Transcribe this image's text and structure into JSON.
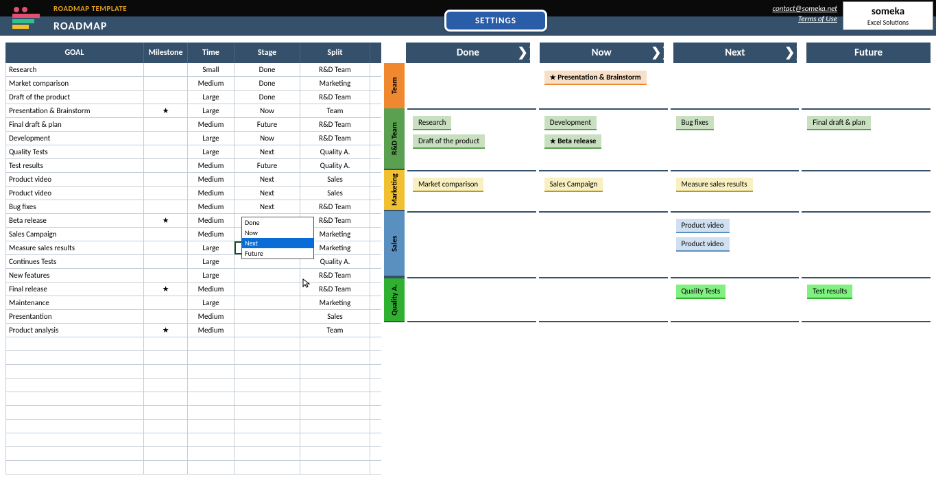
{
  "header": {
    "small_title": "ROADMAP TEMPLATE",
    "big_title": "ROADMAP",
    "settings": "SETTINGS",
    "contact": "contact@someka.net",
    "terms": "Terms of Use",
    "logo_text": "someka",
    "logo_sub": "Excel Solutions"
  },
  "columns": {
    "goal": "GOAL",
    "milestone": "Milestone",
    "time": "Time",
    "stage": "Stage",
    "split": "Split"
  },
  "stages": [
    "Done",
    "Now",
    "Next",
    "Future"
  ],
  "dropdown": [
    "Done",
    "Now",
    "Next",
    "Future"
  ],
  "lanes": {
    "team": "Team",
    "rd": "R&D Team",
    "mkt": "Marketing",
    "sales": "Sales",
    "qa": "Quality A."
  },
  "rows": [
    {
      "goal": "Research",
      "mile": "",
      "time": "Small",
      "stage": "Done",
      "split": "R&D Team"
    },
    {
      "goal": "Market comparison",
      "mile": "",
      "time": "Medium",
      "stage": "Done",
      "split": "Marketing"
    },
    {
      "goal": "Draft of the product",
      "mile": "",
      "time": "Large",
      "stage": "Done",
      "split": "R&D Team"
    },
    {
      "goal": "Presentation & Brainstorm",
      "mile": "★",
      "time": "Large",
      "stage": "Now",
      "split": "Team"
    },
    {
      "goal": "Final draft & plan",
      "mile": "",
      "time": "Medium",
      "stage": "Future",
      "split": "R&D Team"
    },
    {
      "goal": "Development",
      "mile": "",
      "time": "Large",
      "stage": "Now",
      "split": "R&D Team"
    },
    {
      "goal": "Quality Tests",
      "mile": "",
      "time": "Large",
      "stage": "Next",
      "split": "Quality A."
    },
    {
      "goal": "Test results",
      "mile": "",
      "time": "Medium",
      "stage": "Future",
      "split": "Quality A."
    },
    {
      "goal": "Product video",
      "mile": "",
      "time": "Medium",
      "stage": "Next",
      "split": "Sales"
    },
    {
      "goal": "Product video",
      "mile": "",
      "time": "Medium",
      "stage": "Next",
      "split": "Sales"
    },
    {
      "goal": "Bug fixes",
      "mile": "",
      "time": "Medium",
      "stage": "Next",
      "split": "R&D Team"
    },
    {
      "goal": "Beta release",
      "mile": "★",
      "time": "Medium",
      "stage": "Now",
      "split": "R&D Team"
    },
    {
      "goal": "Sales Campaign",
      "mile": "",
      "time": "Medium",
      "stage": "Now",
      "split": "Marketing"
    },
    {
      "goal": "Measure sales results",
      "mile": "",
      "time": "Large",
      "stage": "Next",
      "split": "Marketing"
    },
    {
      "goal": "Continues Tests",
      "mile": "",
      "time": "Large",
      "stage": "",
      "split": "Quality A."
    },
    {
      "goal": "New features",
      "mile": "",
      "time": "Large",
      "stage": "",
      "split": "R&D Team"
    },
    {
      "goal": "Final release",
      "mile": "★",
      "time": "Medium",
      "stage": "",
      "split": "R&D Team"
    },
    {
      "goal": "Maintenance",
      "mile": "",
      "time": "Large",
      "stage": "",
      "split": "Marketing"
    },
    {
      "goal": "Presentantion",
      "mile": "",
      "time": "Medium",
      "stage": "",
      "split": "Sales"
    },
    {
      "goal": "Product analysis",
      "mile": "★",
      "time": "Medium",
      "stage": "",
      "split": "Team"
    }
  ],
  "cards": {
    "team": {
      "Now": [
        {
          "t": "Presentation & Brainstorm",
          "m": true
        }
      ]
    },
    "rd": {
      "Done": [
        {
          "t": "Research"
        },
        {
          "t": "Draft of the product"
        }
      ],
      "Now": [
        {
          "t": "Development"
        },
        {
          "t": "Beta release",
          "m": true
        }
      ],
      "Next": [
        {
          "t": "Bug fixes"
        }
      ],
      "Future": [
        {
          "t": "Final draft & plan"
        }
      ]
    },
    "mkt": {
      "Done": [
        {
          "t": "Market comparison"
        }
      ],
      "Now": [
        {
          "t": "Sales Campaign"
        }
      ],
      "Next": [
        {
          "t": "Measure sales results"
        }
      ]
    },
    "sales": {
      "Next": [
        {
          "t": "Product video"
        },
        {
          "t": "Product video"
        }
      ]
    },
    "qa": {
      "Next": [
        {
          "t": "Quality Tests"
        }
      ],
      "Future": [
        {
          "t": "Test results"
        }
      ]
    }
  }
}
